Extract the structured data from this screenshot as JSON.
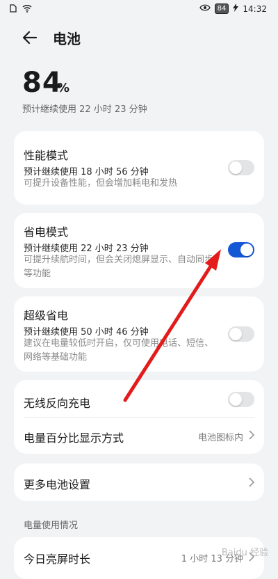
{
  "status_bar": {
    "battery_level": "84",
    "time": "14:32"
  },
  "header": {
    "title": "电池"
  },
  "battery": {
    "percent": "84",
    "percent_sign": "%",
    "remaining": "预计继续使用 22 小时 23 分钟"
  },
  "modes": [
    {
      "title": "性能模式",
      "subtitle": "预计继续使用 18 小时 56 分钟",
      "desc": "可提升设备性能，但会增加耗电和发热",
      "enabled": false
    },
    {
      "title": "省电模式",
      "subtitle": "预计继续使用 22 小时 23 分钟",
      "desc": "可提升续航时间，但会关闭熄屏显示、自动同步等功能",
      "enabled": true
    },
    {
      "title": "超级省电",
      "subtitle": "预计继续使用 50 小时 46 分钟",
      "desc": "建议在电量较低时开启，仅可使用电话、短信、网络等基础功能",
      "enabled": false
    }
  ],
  "settings": {
    "wireless_reverse": "无线反向充电",
    "wireless_reverse_enabled": false,
    "percentage_display": "电量百分比显示方式",
    "percentage_display_value": "电池图标内",
    "more_settings": "更多电池设置"
  },
  "usage": {
    "section_title": "电量使用情况",
    "screen_time_label": "今日亮屏时长",
    "screen_time_value": "1 小时 13 分钟"
  },
  "colors": {
    "accent": "#1558d6",
    "annotation_arrow": "#e31b1b"
  },
  "watermark": "Baidu 经验"
}
